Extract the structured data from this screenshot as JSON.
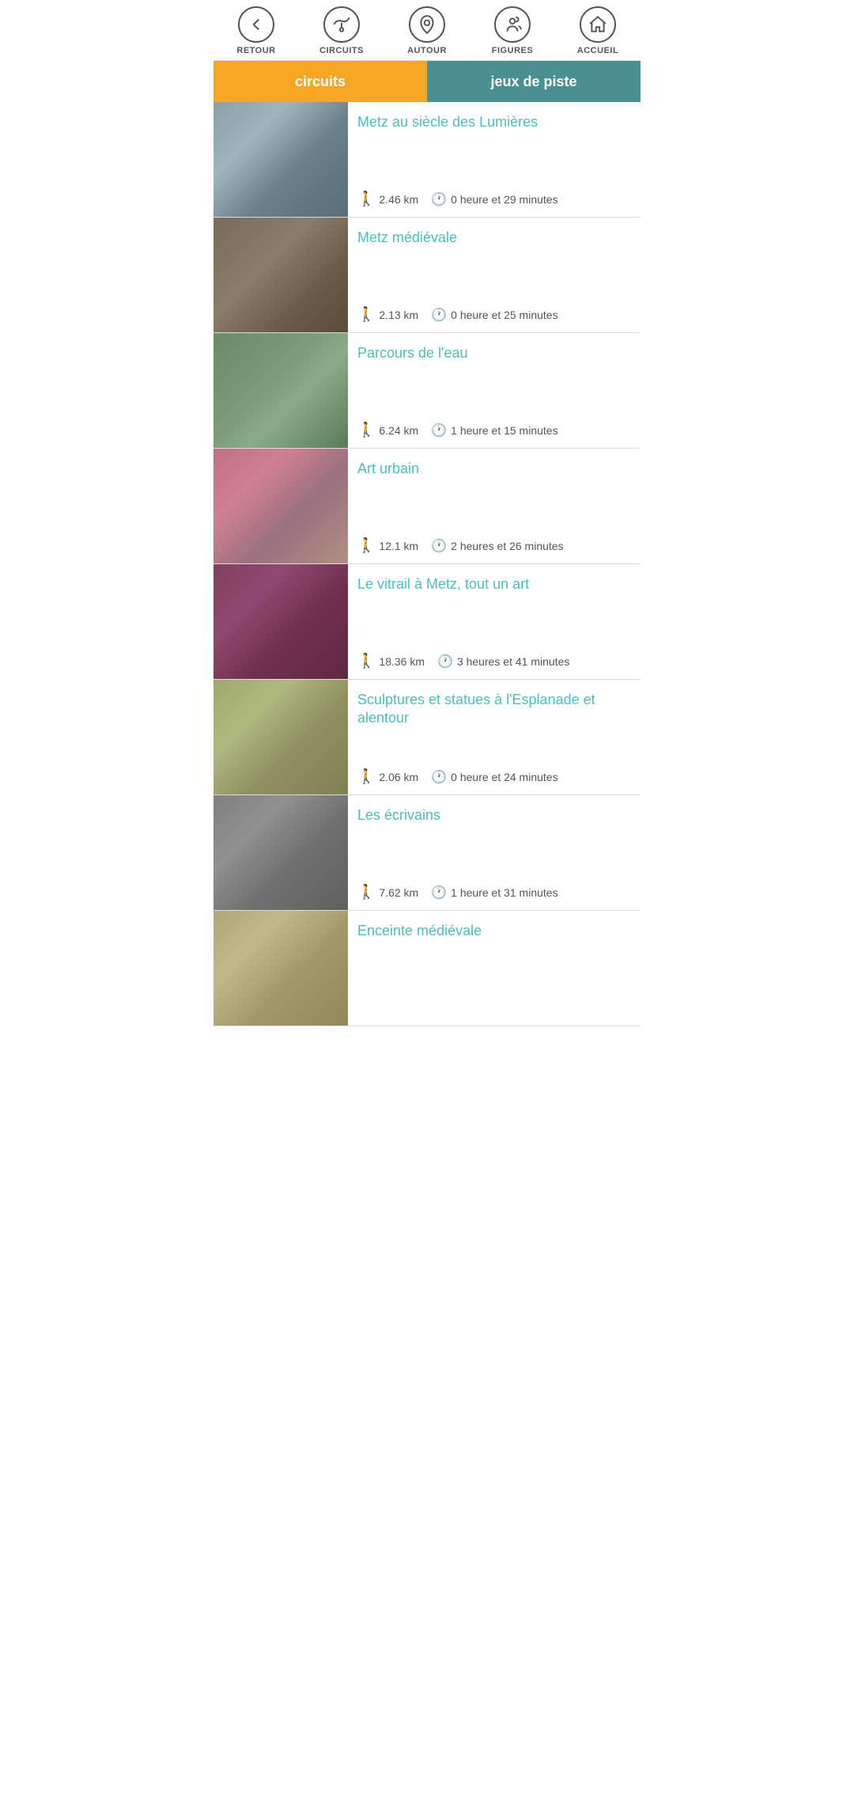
{
  "header": {
    "nav_items": [
      {
        "id": "retour",
        "label": "RETOUR",
        "icon": "back"
      },
      {
        "id": "circuits",
        "label": "CIRCUITS",
        "icon": "circuits"
      },
      {
        "id": "autour",
        "label": "AUTOUR",
        "icon": "autour"
      },
      {
        "id": "figures",
        "label": "FIGURES",
        "icon": "figures"
      },
      {
        "id": "accueil",
        "label": "ACCUEIL",
        "icon": "home"
      }
    ]
  },
  "tabs": [
    {
      "id": "circuits",
      "label": "circuits",
      "active": true
    },
    {
      "id": "jeux",
      "label": "jeux de piste",
      "active": false
    }
  ],
  "circuits": [
    {
      "id": 1,
      "title": "Metz au siècle des Lumières",
      "distance": "2.46 km",
      "duration": "0 heure et 29 minutes",
      "image_class": "img-lumières"
    },
    {
      "id": 2,
      "title": "Metz médiévale",
      "distance": "2.13 km",
      "duration": "0 heure et 25 minutes",
      "image_class": "img-medievale"
    },
    {
      "id": 3,
      "title": "Parcours de l'eau",
      "distance": "6.24 km",
      "duration": "1 heure et 15 minutes",
      "image_class": "img-eau"
    },
    {
      "id": 4,
      "title": "Art urbain",
      "distance": "12.1 km",
      "duration": "2 heures et 26 minutes",
      "image_class": "img-urbain"
    },
    {
      "id": 5,
      "title": "Le vitrail à Metz, tout un art",
      "distance": "18.36 km",
      "duration": "3 heures et 41 minutes",
      "image_class": "img-vitrail"
    },
    {
      "id": 6,
      "title": "Sculptures et statues à l'Esplanade et alentour",
      "distance": "2.06 km",
      "duration": "0 heure et 24 minutes",
      "image_class": "img-sculptures"
    },
    {
      "id": 7,
      "title": "Les écrivains",
      "distance": "7.62 km",
      "duration": "1 heure et 31 minutes",
      "image_class": "img-ecrivains"
    },
    {
      "id": 8,
      "title": "Enceinte médiévale",
      "distance": "",
      "duration": "",
      "image_class": "img-enceinte"
    }
  ]
}
